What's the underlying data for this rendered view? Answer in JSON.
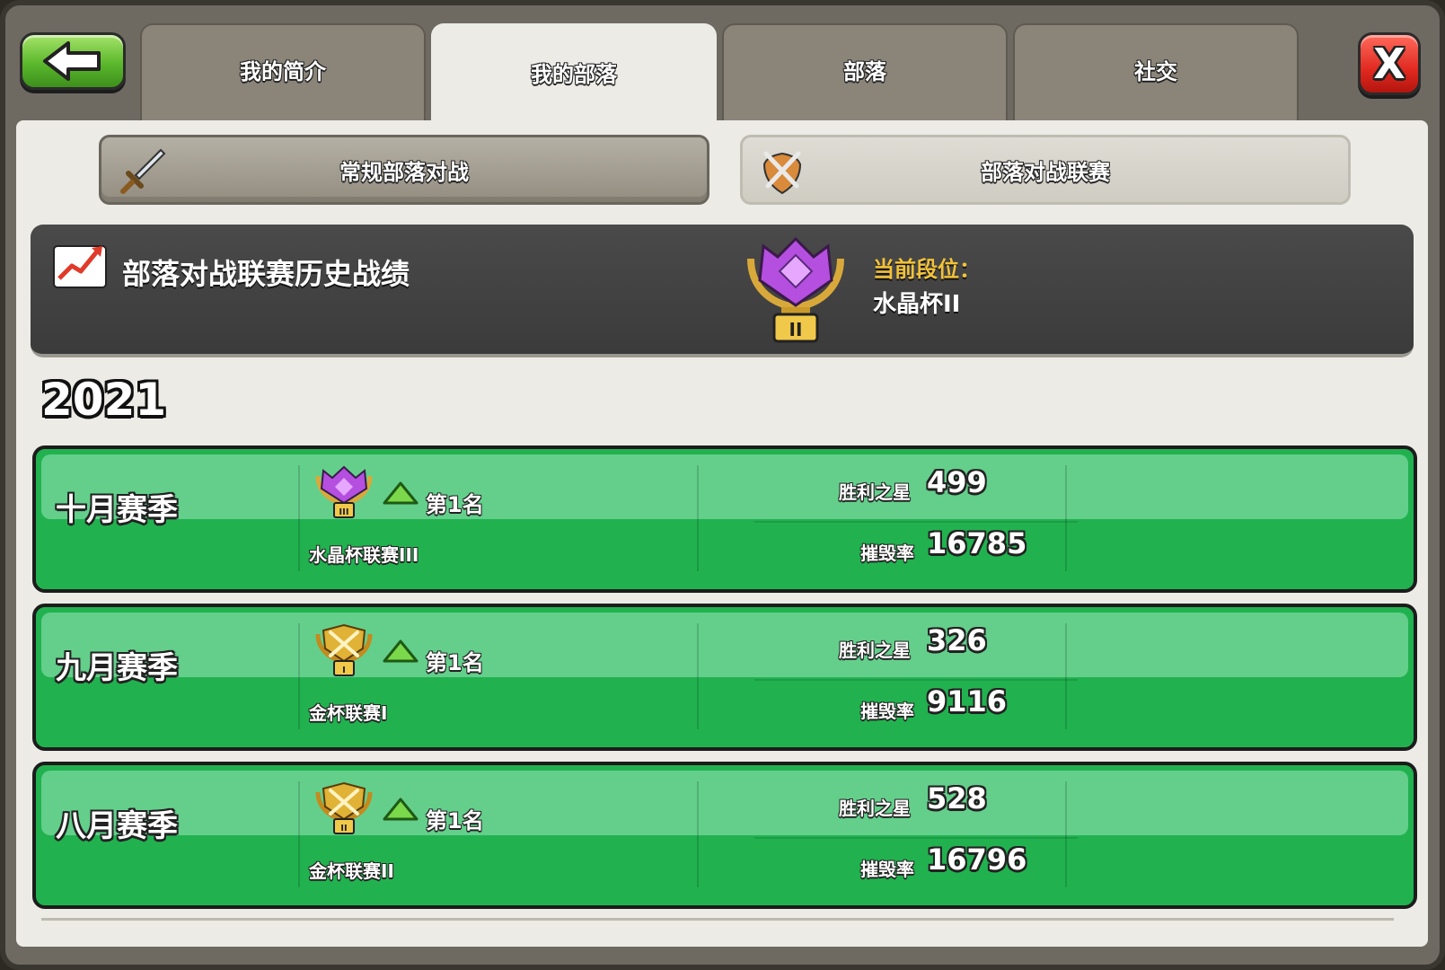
{
  "tabs": [
    {
      "label": "我的简介",
      "active": false
    },
    {
      "label": "我的部落",
      "active": true
    },
    {
      "label": "部落",
      "active": false
    },
    {
      "label": "社交",
      "active": false
    }
  ],
  "close_label": "X",
  "sub_tabs": {
    "regular": "常规部落对战",
    "league": "部落对战联赛"
  },
  "history": {
    "title": "部落对战联赛历史战绩",
    "current_rank_label": "当前段位：",
    "current_rank_value": "水晶杯II",
    "badge_numeral": "II"
  },
  "year": "2021",
  "seasons": [
    {
      "name": "十月赛季",
      "rank": "第1名",
      "league": "水晶杯联赛III",
      "badge": "crystal",
      "badge_numeral": "III",
      "stars_label": "胜利之星",
      "stars": "499",
      "destruction_label": "摧毁率",
      "destruction": "16785"
    },
    {
      "name": "九月赛季",
      "rank": "第1名",
      "league": "金杯联赛I",
      "badge": "gold",
      "badge_numeral": "I",
      "stars_label": "胜利之星",
      "stars": "326",
      "destruction_label": "摧毁率",
      "destruction": "9116"
    },
    {
      "name": "八月赛季",
      "rank": "第1名",
      "league": "金杯联赛II",
      "badge": "gold",
      "badge_numeral": "II",
      "stars_label": "胜利之星",
      "stars": "528",
      "destruction_label": "摧毁率",
      "destruction": "16796"
    }
  ],
  "colors": {
    "green_row": "#21b24f",
    "rank_label": "#f2c23a",
    "crystal": "#b54fe0",
    "gold": "#e0b235"
  }
}
